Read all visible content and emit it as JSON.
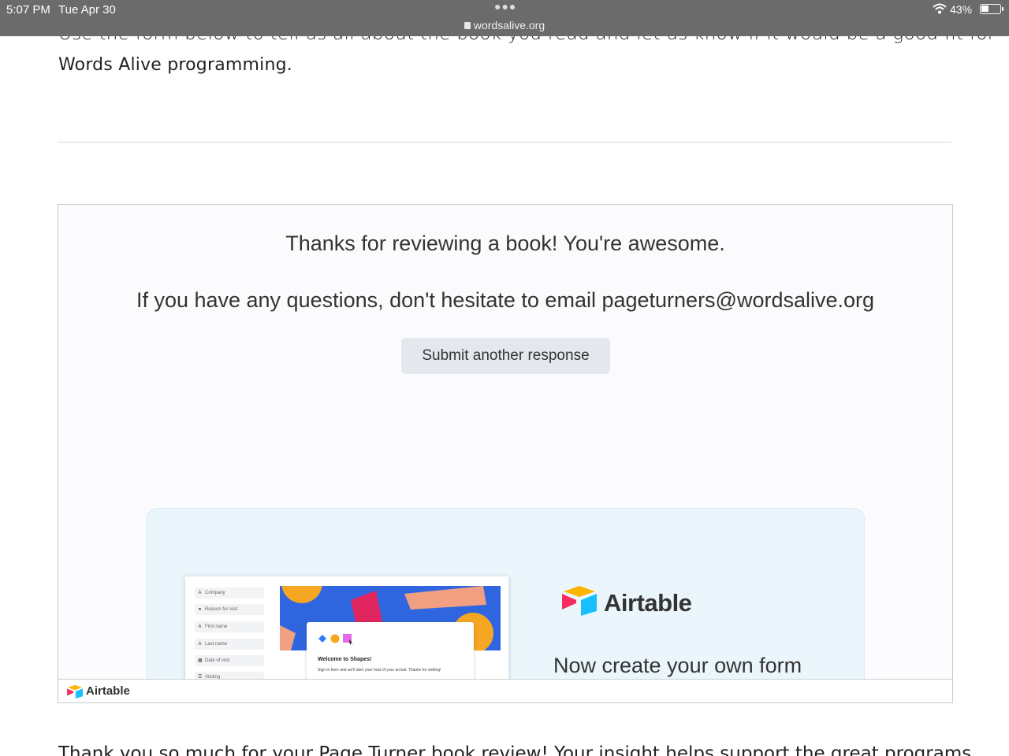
{
  "status_bar": {
    "time": "5:07 PM",
    "date": "Tue Apr 30",
    "url": "wordsalive.org",
    "battery_percent_label": "43%",
    "battery_level": 0.43
  },
  "page": {
    "intro_line1": "Use the form below to tell us all about the book you read and let us know if it would be a good fit for",
    "intro_line2": "Words Alive programming.",
    "bottom_text": "Thank you so much for your Page Turner book review! Your insight helps support the great programs"
  },
  "embed": {
    "thanks_message": "Thanks for reviewing a book! You're awesome.",
    "question_message": "If you have any questions, don't hesitate to email pageturners@wordsalive.org",
    "submit_another_label": "Submit another response",
    "promo": {
      "brand_name": "Airtable",
      "cta": "Now create your own form",
      "preview_fields": [
        "Company",
        "Reason for visit",
        "First name",
        "Last name",
        "Date of visit",
        "Visiting"
      ],
      "preview_title": "Welcome to Shapes!",
      "preview_subtitle": "Sign in here and we'll alert your host of your arrival. Thanks for visiting!"
    },
    "footer_brand": "Airtable"
  }
}
